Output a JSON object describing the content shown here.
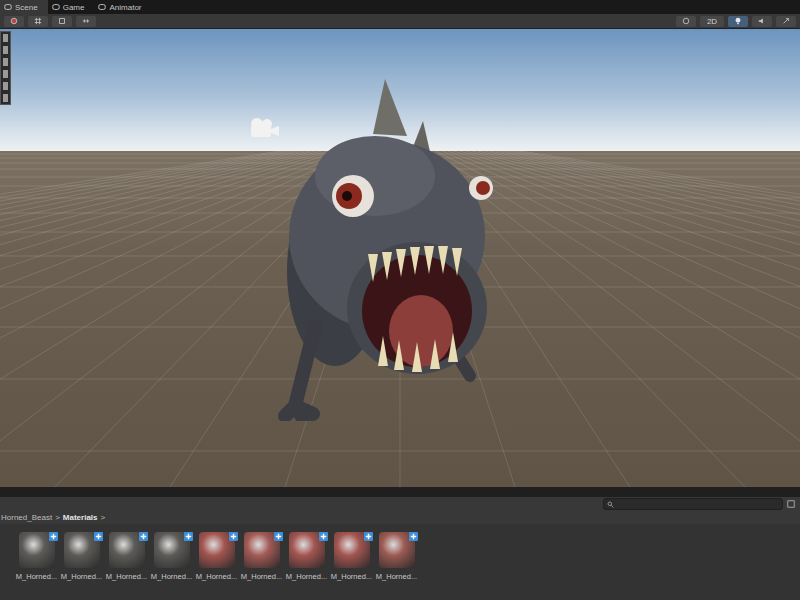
{
  "tabs": [
    {
      "label": "Scene",
      "selected": true
    },
    {
      "label": "Game",
      "selected": false
    },
    {
      "label": "Animator",
      "selected": false
    }
  ],
  "toolbar": {
    "mode_2d": {
      "label": "2D",
      "selected": false
    },
    "lighting": {
      "selected": true
    }
  },
  "project": {
    "breadcrumb": [
      "Horned_Beast",
      "Materials"
    ],
    "separator": ">",
    "items": [
      {
        "label": "M_Horned...",
        "color": "#5c5b58"
      },
      {
        "label": "M_Horned...",
        "color": "#5c5b58"
      },
      {
        "label": "M_Horned...",
        "color": "#5c5b58"
      },
      {
        "label": "M_Horned...",
        "color": "#5c5b58"
      },
      {
        "label": "M_Horned...",
        "color": "#a35550"
      },
      {
        "label": "M_Horned...",
        "color": "#a35a55"
      },
      {
        "label": "M_Horned...",
        "color": "#a35550"
      },
      {
        "label": "M_Horned...",
        "color": "#a35550"
      },
      {
        "label": "M_Horned...",
        "color": "#9c5a52"
      }
    ]
  }
}
